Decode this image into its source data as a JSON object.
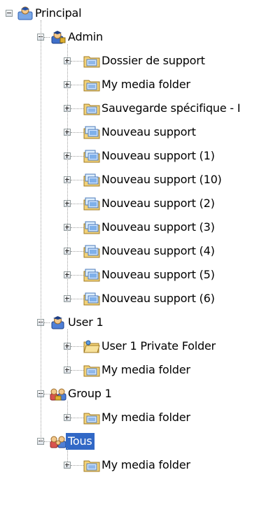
{
  "tree": {
    "root": {
      "label": "Principal",
      "icon": "user-group-blue-icon",
      "expanded": true
    },
    "groups": [
      {
        "label": "Admin",
        "icon": "admin-user-icon",
        "expanded": true,
        "children": [
          {
            "label": "Dossier de support",
            "icon": "media-folder-icon"
          },
          {
            "label": "My media folder",
            "icon": "media-folder-icon"
          },
          {
            "label": "Sauvegarde spécifique - I",
            "icon": "media-folder-icon"
          },
          {
            "label": "Nouveau support",
            "icon": "media-stack-icon"
          },
          {
            "label": "Nouveau support (1)",
            "icon": "media-stack-icon"
          },
          {
            "label": "Nouveau support (10)",
            "icon": "media-stack-icon"
          },
          {
            "label": "Nouveau support (2)",
            "icon": "media-stack-icon"
          },
          {
            "label": "Nouveau support (3)",
            "icon": "media-stack-icon"
          },
          {
            "label": "Nouveau support (4)",
            "icon": "media-stack-icon"
          },
          {
            "label": "Nouveau support (5)",
            "icon": "media-stack-icon"
          },
          {
            "label": "Nouveau support (6)",
            "icon": "media-stack-icon"
          }
        ]
      },
      {
        "label": "User 1",
        "icon": "user-icon",
        "expanded": true,
        "children": [
          {
            "label": "User 1 Private Folder",
            "icon": "private-folder-icon"
          },
          {
            "label": "My media folder",
            "icon": "media-folder-icon"
          }
        ]
      },
      {
        "label": "Group 1",
        "icon": "group-icon",
        "expanded": true,
        "children": [
          {
            "label": "My media folder",
            "icon": "media-folder-icon"
          }
        ]
      },
      {
        "label": "Tous",
        "icon": "everyone-group-icon",
        "expanded": true,
        "selected": true,
        "children": [
          {
            "label": "My media folder",
            "icon": "media-folder-icon"
          }
        ]
      }
    ]
  },
  "colors": {
    "selection": "#3168c6",
    "selection_text": "#ffffff",
    "tree_lines": "#a0a0a0"
  }
}
